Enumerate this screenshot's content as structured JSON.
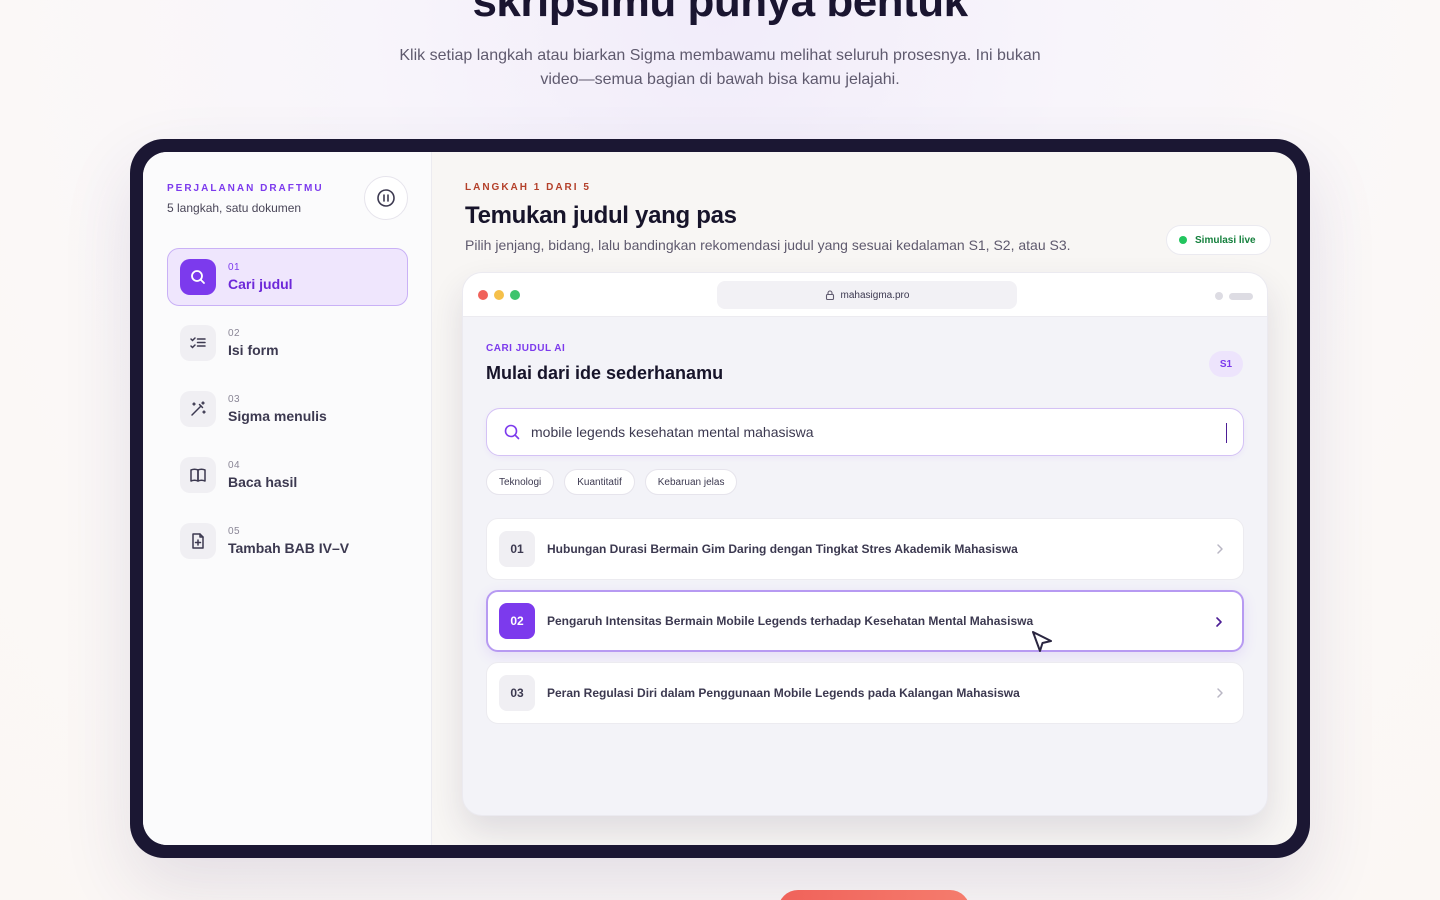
{
  "hero": {
    "title": "skripsimu punya bentuk",
    "subtitle": "Klik setiap langkah atau biarkan Sigma membawamu melihat seluruh prosesnya. Ini bukan video—semua bagian di bawah bisa kamu jelajahi."
  },
  "sidebar": {
    "kicker": "PERJALANAN DRAFTMU",
    "subtitle": "5 langkah, satu dokumen",
    "pause_icon": "pause-icon",
    "steps": [
      {
        "num": "01",
        "label": "Cari judul",
        "icon": "search-icon",
        "active": true
      },
      {
        "num": "02",
        "label": "Isi form",
        "icon": "checklist-icon",
        "active": false
      },
      {
        "num": "03",
        "label": "Sigma menulis",
        "icon": "magic-wand-icon",
        "active": false
      },
      {
        "num": "04",
        "label": "Baca hasil",
        "icon": "book-icon",
        "active": false
      },
      {
        "num": "05",
        "label": "Tambah BAB IV–V",
        "icon": "file-plus-icon",
        "active": false
      }
    ]
  },
  "main": {
    "kicker": "LANGKAH 1 DARI 5",
    "title": "Temukan judul yang pas",
    "description": "Pilih jenjang, bidang, lalu bandingkan rekomendasi judul yang sesuai kedalaman S1, S2, atau S3.",
    "live_badge": "Simulasi live"
  },
  "browser": {
    "url": "mahasigma.pro",
    "kicker": "CARI JUDUL AI",
    "title": "Mulai dari ide sederhanamu",
    "level": "S1",
    "search_value": "mobile legends kesehatan mental mahasiswa",
    "chips": [
      "Teknologi",
      "Kuantitatif",
      "Kebaruan jelas"
    ],
    "results": [
      {
        "num": "01",
        "title": "Hubungan Durasi Bermain Gim Daring dengan Tingkat Stres Akademik Mahasiswa",
        "selected": false
      },
      {
        "num": "02",
        "title": "Pengaruh Intensitas Bermain Mobile Legends terhadap Kesehatan Mental Mahasiswa",
        "selected": true
      },
      {
        "num": "03",
        "title": "Peran Regulasi Diri dalam Penggunaan Mobile Legends pada Kalangan Mahasiswa",
        "selected": false
      }
    ]
  },
  "colors": {
    "accent": "#7c3aed",
    "accent_soft": "#efe6fd",
    "frame": "#1b1733",
    "kicker_main": "#b4402a",
    "live": "#22c55e",
    "cta": "#f0625a"
  }
}
